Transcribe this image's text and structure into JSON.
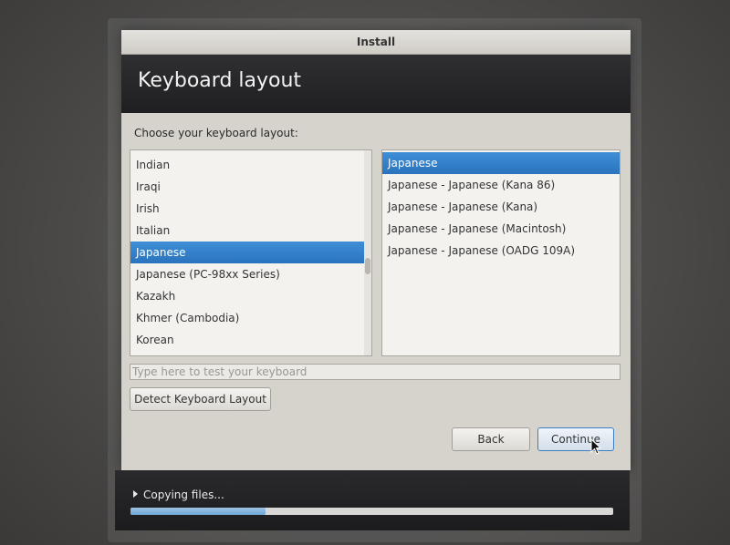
{
  "window": {
    "title": "Install"
  },
  "header": {
    "title": "Keyboard layout"
  },
  "prompt": "Choose your keyboard layout:",
  "layouts": {
    "items": [
      "Indian",
      "Iraqi",
      "Irish",
      "Italian",
      "Japanese",
      "Japanese (PC-98xx Series)",
      "Kazakh",
      "Khmer (Cambodia)",
      "Korean"
    ],
    "selected": "Japanese"
  },
  "variants": {
    "items": [
      "Japanese",
      "Japanese - Japanese (Kana 86)",
      "Japanese - Japanese (Kana)",
      "Japanese - Japanese (Macintosh)",
      "Japanese - Japanese (OADG 109A)"
    ],
    "selected": "Japanese"
  },
  "test_input": {
    "placeholder": "Type here to test your keyboard",
    "value": ""
  },
  "buttons": {
    "detect": "Detect Keyboard Layout",
    "back": "Back",
    "continue": "Continue"
  },
  "progress": {
    "label": "Copying files...",
    "fraction": 0.28
  },
  "icons": {
    "expander": "triangle-right-icon",
    "cursor": "mouse-pointer-icon"
  },
  "colors": {
    "selection": "#2a73bd",
    "header_bg": "#1f1f21",
    "progress_fill": "#6fa6d6"
  }
}
